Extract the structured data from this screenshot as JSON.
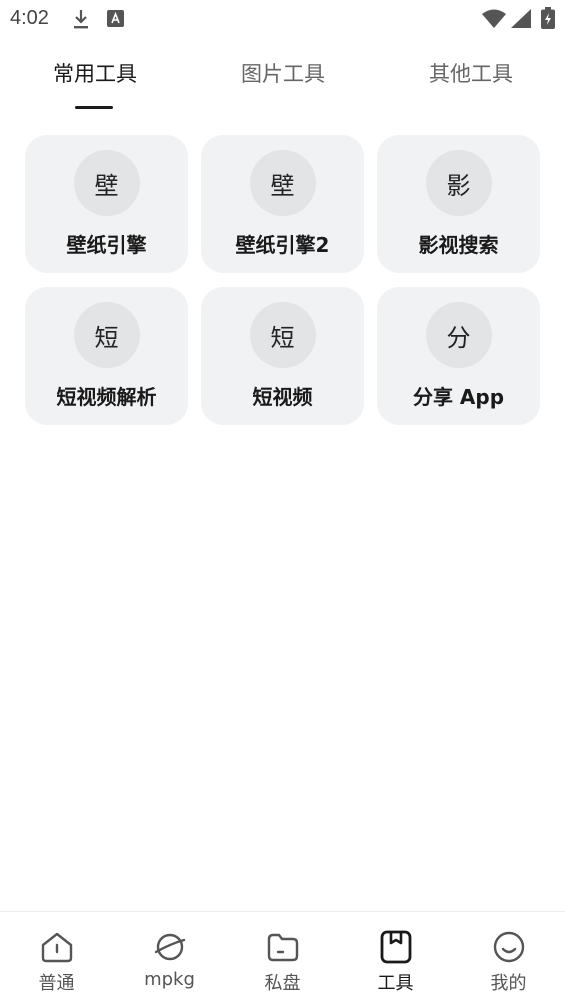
{
  "status_bar": {
    "time": "4:02",
    "icons": [
      "download-icon",
      "app-notification-icon",
      "wifi-icon",
      "signal-icon",
      "battery-charging-icon"
    ]
  },
  "tabs": [
    {
      "label": "常用工具",
      "active": true
    },
    {
      "label": "图片工具",
      "active": false
    },
    {
      "label": "其他工具",
      "active": false
    }
  ],
  "tools": [
    {
      "badge": "壁",
      "label": "壁纸引擎"
    },
    {
      "badge": "壁",
      "label": "壁纸引擎2"
    },
    {
      "badge": "影",
      "label": "影视搜索"
    },
    {
      "badge": "短",
      "label": "短视频解析"
    },
    {
      "badge": "短",
      "label": "短视频"
    },
    {
      "badge": "分",
      "label": "分享 App"
    }
  ],
  "bottom_nav": [
    {
      "label": "普通",
      "icon": "home-icon",
      "active": false
    },
    {
      "label": "mpkg",
      "icon": "planet-icon",
      "active": false
    },
    {
      "label": "私盘",
      "icon": "folder-icon",
      "active": false
    },
    {
      "label": "工具",
      "icon": "tools-box-icon",
      "active": true
    },
    {
      "label": "我的",
      "icon": "smile-icon",
      "active": false
    }
  ],
  "colors": {
    "card_bg": "#f1f2f4",
    "badge_bg": "#e3e4e6",
    "text_primary": "#1a1a1a",
    "text_secondary": "#666666"
  }
}
